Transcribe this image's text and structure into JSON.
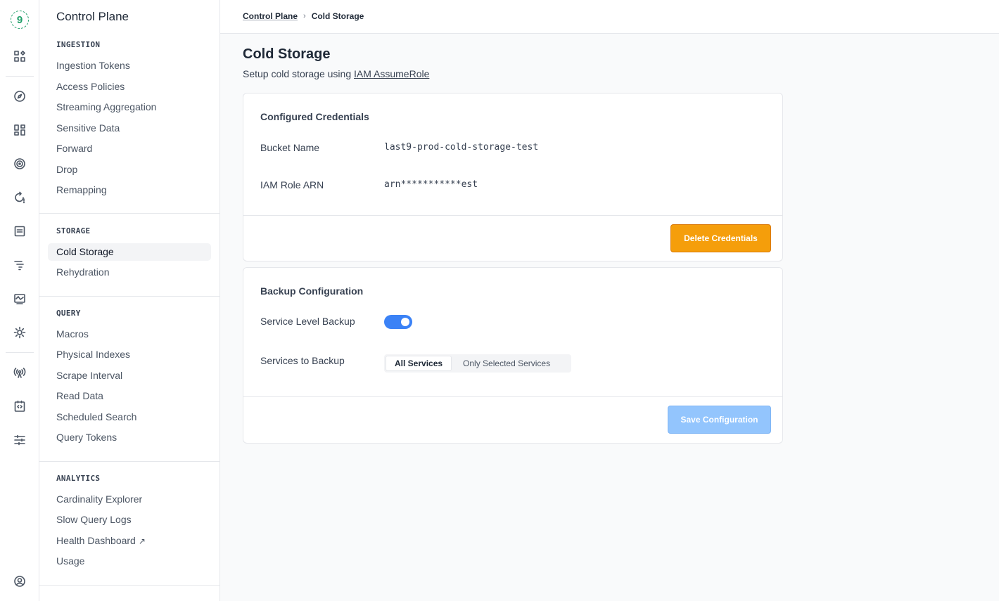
{
  "app": {
    "logo_text": "9"
  },
  "rail": {
    "icons": [
      "dashboard-grid-icon",
      "compass-icon",
      "widgets-icon",
      "target-icon",
      "refresh-alert-icon",
      "document-icon",
      "list-indent-icon",
      "monitor-chart-icon",
      "settings-gear-icon",
      "broadcast-icon",
      "code-box-icon",
      "sliders-icon",
      "user-circle-icon"
    ]
  },
  "sidebar": {
    "title": "Control Plane",
    "groups": [
      {
        "label": "INGESTION",
        "items": [
          "Ingestion Tokens",
          "Access Policies",
          "Streaming Aggregation",
          "Sensitive Data",
          "Forward",
          "Drop",
          "Remapping"
        ]
      },
      {
        "label": "STORAGE",
        "items": [
          "Cold Storage",
          "Rehydration"
        ]
      },
      {
        "label": "QUERY",
        "items": [
          "Macros",
          "Physical Indexes",
          "Scrape Interval",
          "Read Data",
          "Scheduled Search",
          "Query Tokens"
        ]
      },
      {
        "label": "ANALYTICS",
        "items": [
          "Cardinality Explorer",
          "Slow Query Logs",
          "Health Dashboard",
          "Usage"
        ]
      }
    ],
    "external_icon": "↗",
    "active_item": "Cold Storage"
  },
  "breadcrumb": {
    "parent": "Control Plane",
    "current": "Cold Storage"
  },
  "page": {
    "title": "Cold Storage",
    "subtitle_prefix": "Setup cold storage using ",
    "subtitle_link": "IAM AssumeRole"
  },
  "credentials": {
    "title": "Configured Credentials",
    "bucket_label": "Bucket Name",
    "bucket_value": "last9-prod-cold-storage-test",
    "role_label": "IAM Role ARN",
    "role_value": "arn***********est",
    "delete_button": "Delete Credentials"
  },
  "backup": {
    "title": "Backup Configuration",
    "service_backup_label": "Service Level Backup",
    "service_backup_enabled": true,
    "services_label": "Services to Backup",
    "options": [
      "All Services",
      "Only Selected Services"
    ],
    "selected_option": "All Services",
    "save_button": "Save Configuration"
  },
  "colors": {
    "accent_orange": "#f59e0b",
    "accent_blue": "#3b82f6",
    "disabled_blue": "#93c5fd"
  }
}
